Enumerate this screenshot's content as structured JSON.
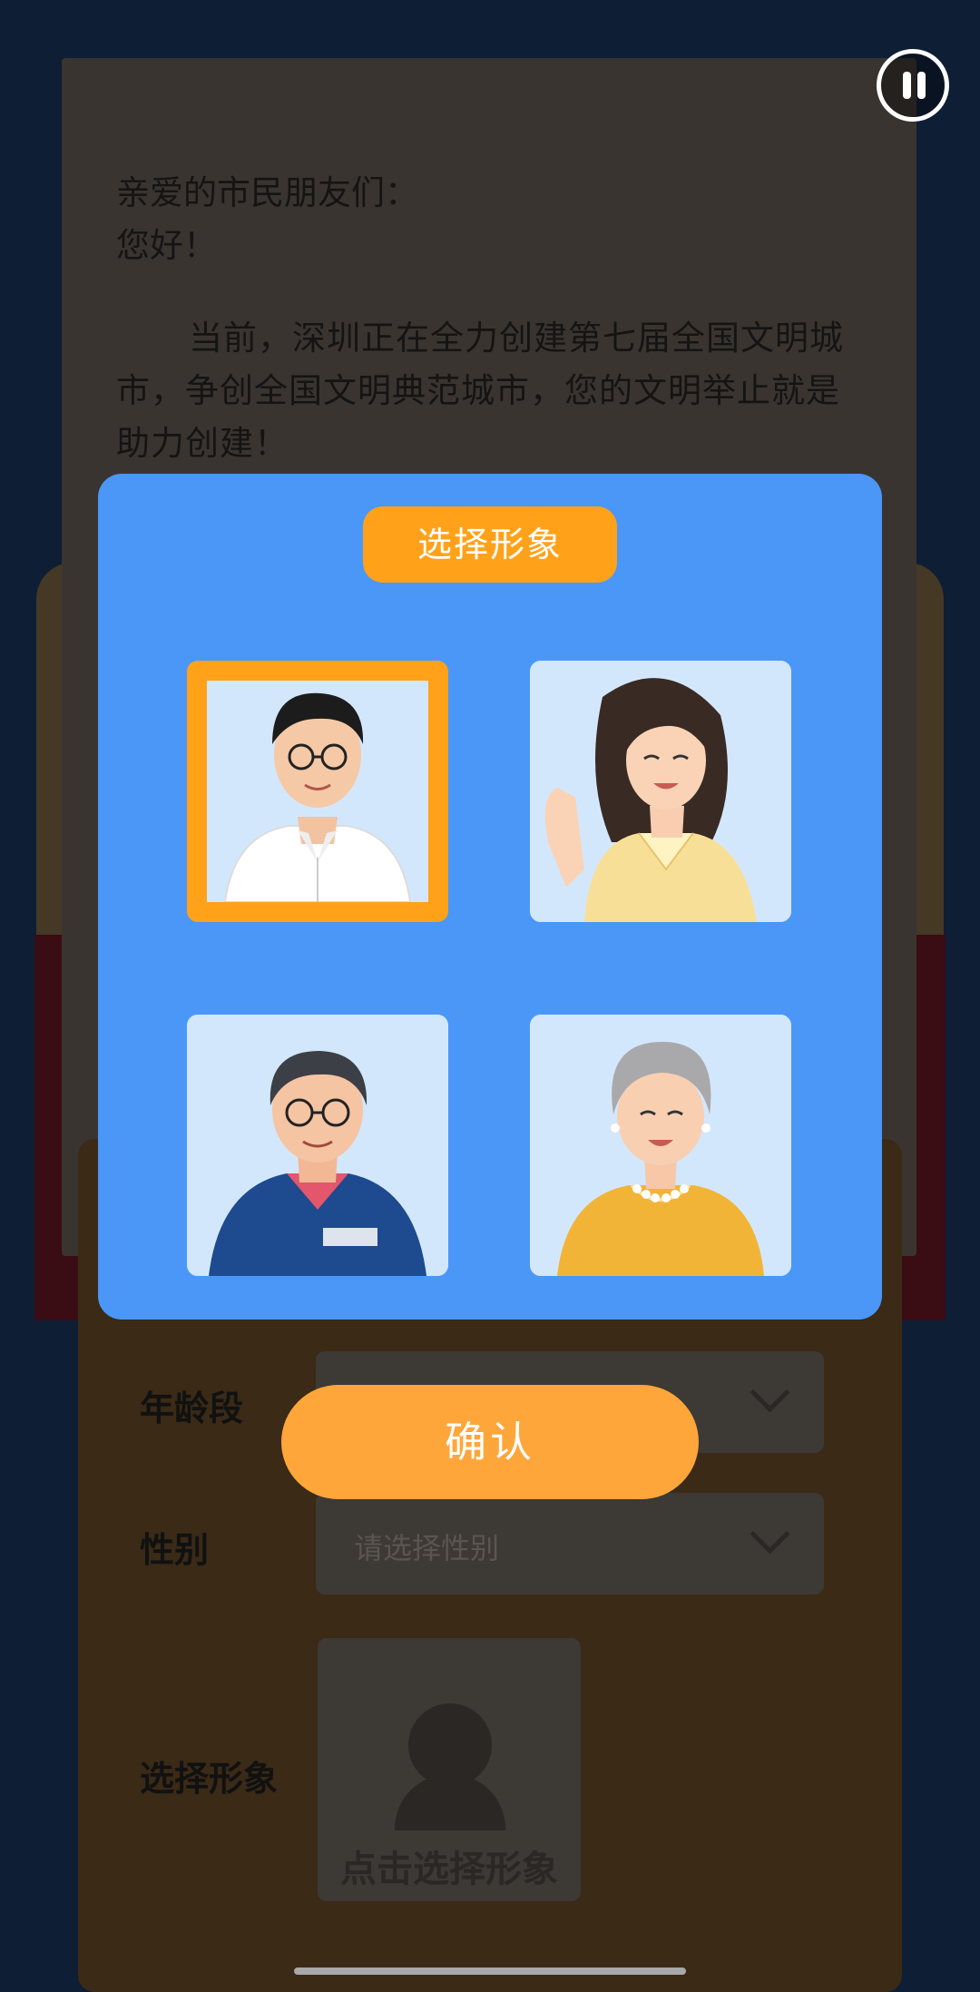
{
  "letter": {
    "salutation": "亲爱的市民朋友们：",
    "hello": "您好！",
    "body": "当前，深圳正在全力创建第七届全国文明城市，争创全国文明典范城市，您的文明举止就是助力创建！"
  },
  "form": {
    "age_label": "年龄段",
    "age_placeholder": "",
    "gender_label": "性别",
    "gender_placeholder": "请选择性别",
    "avatar_label": "选择形象",
    "avatar_picker_text": "点击选择形象"
  },
  "modal": {
    "title": "选择形象",
    "options": [
      {
        "name": "young-man",
        "selected": true
      },
      {
        "name": "young-woman",
        "selected": false
      },
      {
        "name": "elderly-man",
        "selected": false
      },
      {
        "name": "elderly-woman",
        "selected": false
      }
    ],
    "confirm_label": "确认"
  },
  "colors": {
    "modal_bg": "#4a97f7",
    "accent": "#ffa21a",
    "confirm": "#ffa63a",
    "page_bg": "#0e1e35"
  },
  "icons": [
    "pause-icon",
    "chevron-down-icon",
    "person-silhouette-icon"
  ]
}
